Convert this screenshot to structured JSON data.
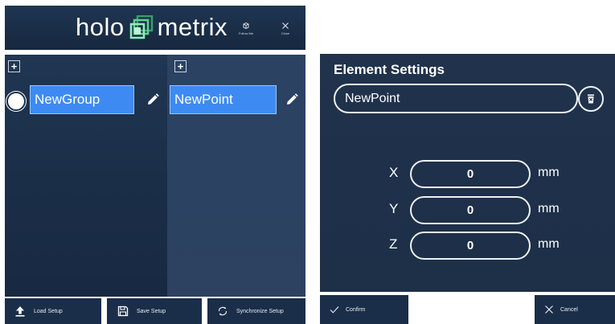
{
  "app": {
    "brand_left": "holo",
    "brand_right": "metrix",
    "follow_label": "Follow Me",
    "close_label": "Close"
  },
  "groups_panel": {
    "add_label": "+",
    "items": [
      {
        "label": "NewGroup",
        "selected": true
      }
    ]
  },
  "points_panel": {
    "add_label": "+",
    "items": [
      {
        "label": "NewPoint"
      }
    ]
  },
  "bottom_bar": {
    "load_label": "Load Setup",
    "save_label": "Save Setup",
    "sync_label": "Synchronize Setup"
  },
  "element_settings": {
    "title": "Element Settings",
    "name_value": "NewPoint",
    "coords": [
      {
        "axis": "X",
        "value": "0",
        "unit": "mm"
      },
      {
        "axis": "Y",
        "value": "0",
        "unit": "mm"
      },
      {
        "axis": "Z",
        "value": "0",
        "unit": "mm"
      }
    ],
    "confirm_label": "Confirm",
    "cancel_label": "Cancel"
  },
  "colors": {
    "selection_blue": "#3d8bf2",
    "panel_dark": "#1a2d47",
    "panel_light": "#2c4262"
  }
}
